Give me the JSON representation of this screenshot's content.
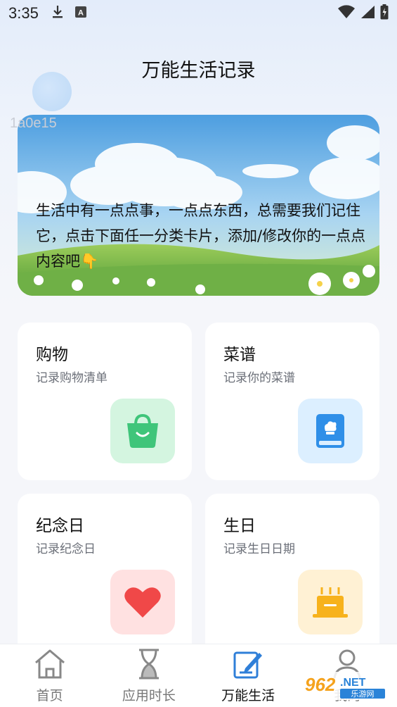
{
  "status_bar": {
    "time": "3:35",
    "icons_left": [
      "download-icon",
      "a-keyboard-icon"
    ],
    "icons_right": [
      "wifi-icon",
      "signal-icon",
      "battery-icon"
    ]
  },
  "page_title": "万能生活记录",
  "watermark_code": "1a0e15",
  "banner": {
    "text": "生活中有一点点事，一点点东西，总需要我们记住它，点击下面任一分类卡片，添加/修改你的一点点内容吧👇"
  },
  "cards": [
    {
      "title": "购物",
      "subtitle": "记录购物清单",
      "icon": "shopping-bag-icon",
      "icon_bg": "#d4f5e0",
      "icon_color": "#3fc57a"
    },
    {
      "title": "菜谱",
      "subtitle": "记录你的菜谱",
      "icon": "recipe-book-icon",
      "icon_bg": "#dcefff",
      "icon_color": "#2f8fe8"
    },
    {
      "title": "纪念日",
      "subtitle": "记录纪念日",
      "icon": "heart-icon",
      "icon_bg": "#ffe1e1",
      "icon_color": "#f04848"
    },
    {
      "title": "生日",
      "subtitle": "记录生日日期",
      "icon": "cake-icon",
      "icon_bg": "#fff1d4",
      "icon_color": "#f7b21c"
    }
  ],
  "bottom_nav": [
    {
      "label": "首页",
      "icon": "home-icon",
      "active": false
    },
    {
      "label": "应用时长",
      "icon": "hourglass-icon",
      "active": false
    },
    {
      "label": "万能生活",
      "icon": "edit-note-icon",
      "active": true
    },
    {
      "label": "我的",
      "icon": "user-icon",
      "active": false
    }
  ],
  "watermark_logo": "962.NET 乐游网"
}
